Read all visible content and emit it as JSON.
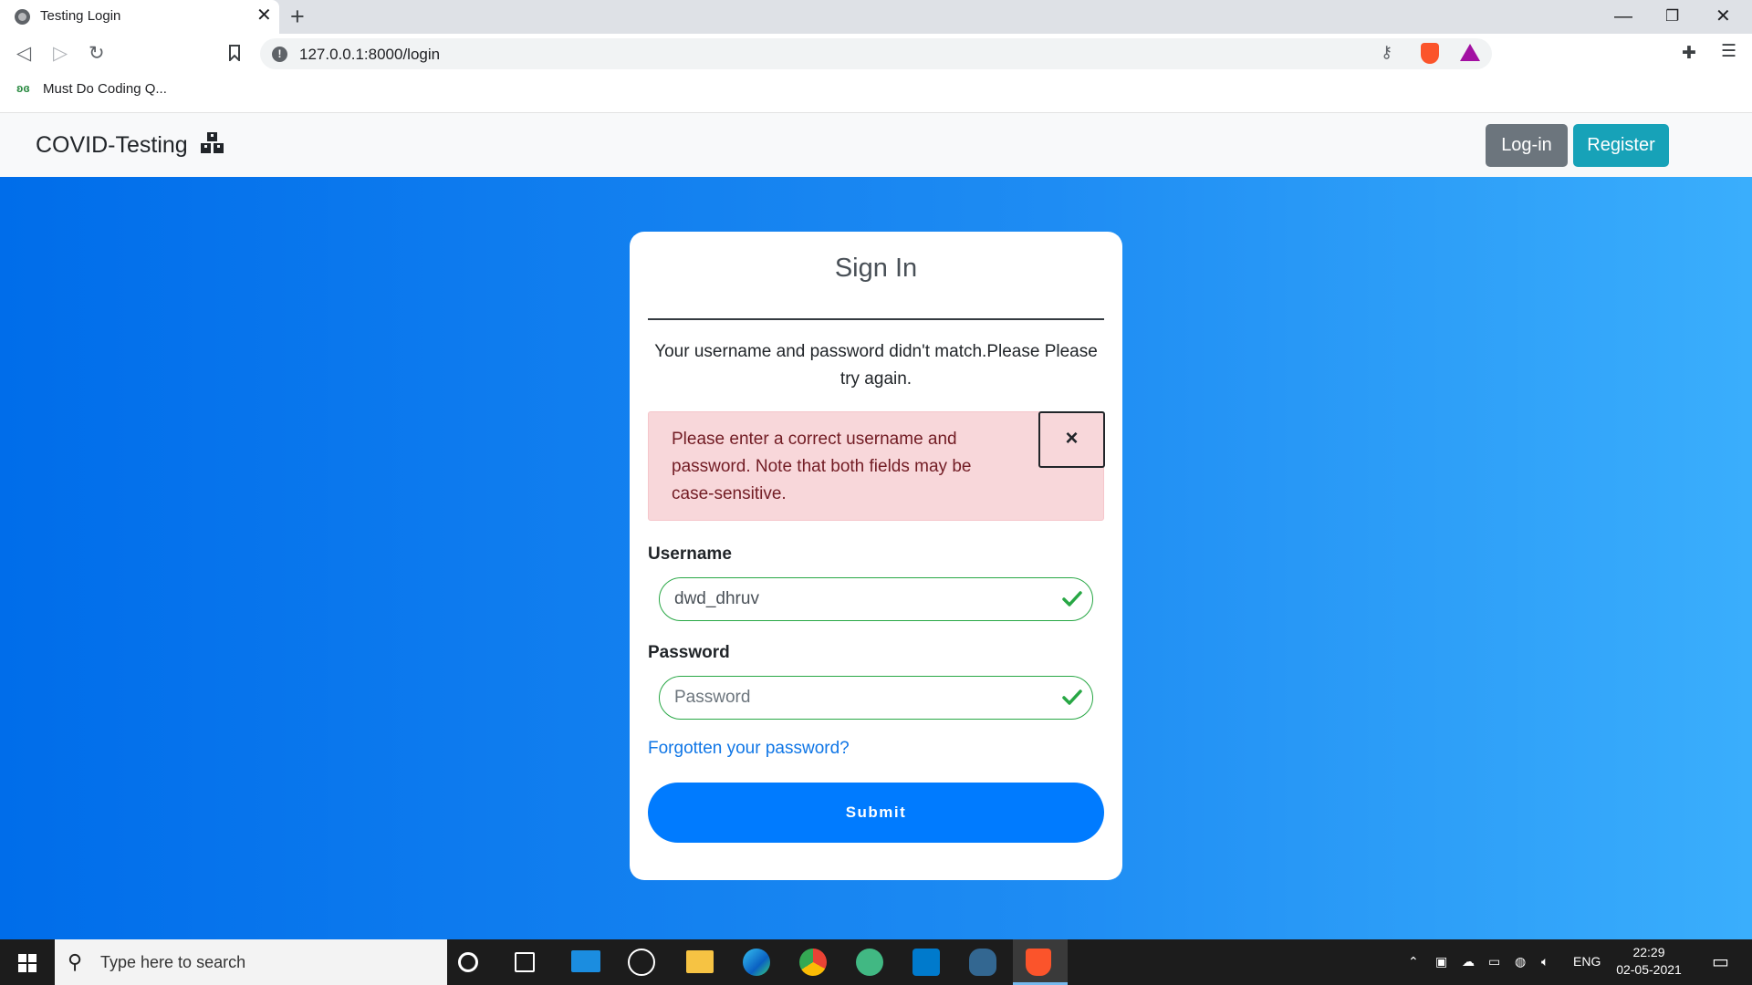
{
  "browser": {
    "tab_title": "Testing Login",
    "tab_close": "✕",
    "new_tab": "+",
    "url": "127.0.0.1:8000/login",
    "bookmark_label": "Must Do Coding Q...",
    "bookmark_icon_text": "ʚɞ",
    "info_icon_text": "!",
    "icons": [
      "globe-icon",
      "back-icon",
      "forward-icon",
      "reload-icon",
      "bookmark-icon",
      "key-icon",
      "brave-shield-icon",
      "brave-rewards-icon",
      "extensions-icon",
      "menu-icon"
    ]
  },
  "navbar": {
    "brand": "COVID-Testing",
    "login_label": "Log-in",
    "register_label": "Register"
  },
  "card": {
    "title": "Sign In",
    "mismatch_message": "Your username and password didn't match.Please Please try again.",
    "alert_text": "Please enter a correct username and password. Note that both fields may be case-sensitive.",
    "alert_close": "×",
    "username_label": "Username",
    "username_value": "dwd_dhruv",
    "password_label": "Password",
    "password_placeholder": "Password",
    "forgot_link": "Forgotten your password?",
    "submit_label": "Submit"
  },
  "taskbar": {
    "search_placeholder": "Type here to search",
    "language": "ENG",
    "time": "22:29",
    "date": "02-05-2021",
    "apps": [
      "cortana",
      "task-view",
      "mail",
      "dell",
      "file-explorer",
      "edge",
      "chrome",
      "atom",
      "vscode",
      "pgadmin",
      "brave"
    ]
  },
  "colors": {
    "gradient_start": "#006dea",
    "gradient_end": "#3aaefc",
    "valid_green": "#28a745",
    "primary": "#007bff",
    "alert_bg": "#f8d7da"
  }
}
